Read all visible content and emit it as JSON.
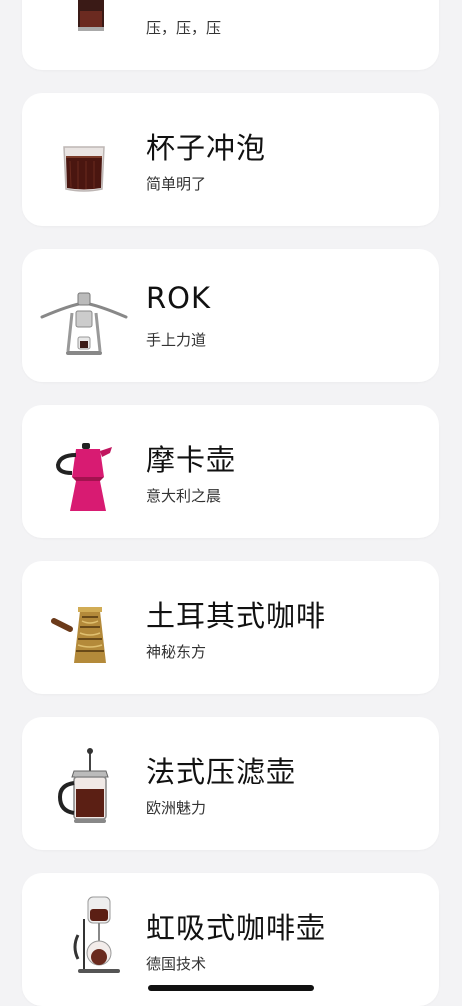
{
  "items": [
    {
      "title": "",
      "subtitle": "压，压，压",
      "icon": "aeropress-icon"
    },
    {
      "title": "杯子冲泡",
      "subtitle": "简单明了",
      "icon": "coffee-cup-icon"
    },
    {
      "title": "ROK",
      "subtitle": "手上力道",
      "icon": "rok-press-icon"
    },
    {
      "title": "摩卡壶",
      "subtitle": "意大利之晨",
      "icon": "moka-pot-icon"
    },
    {
      "title": "土耳其式咖啡",
      "subtitle": "神秘东方",
      "icon": "turkish-cezve-icon"
    },
    {
      "title": "法式压滤壶",
      "subtitle": "欧洲魅力",
      "icon": "french-press-icon"
    },
    {
      "title": "虹吸式咖啡壶",
      "subtitle": "德国技术",
      "icon": "siphon-icon"
    }
  ],
  "colors": {
    "background": "#f3f3f5",
    "card": "#ffffff",
    "moka_pink": "#d81b72",
    "coffee": "#5b1f14"
  }
}
